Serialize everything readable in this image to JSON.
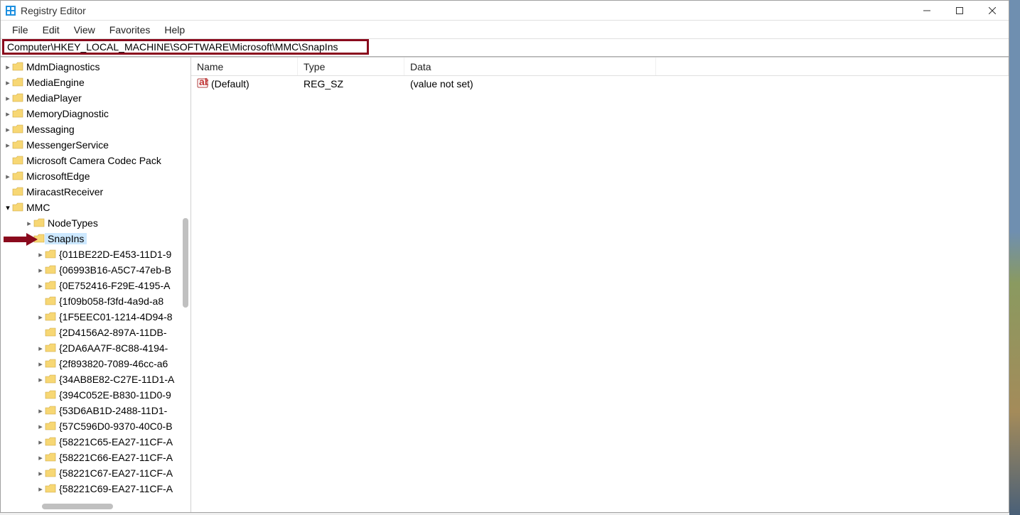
{
  "window": {
    "title": "Registry Editor"
  },
  "menu": {
    "file": "File",
    "edit": "Edit",
    "view": "View",
    "favorites": "Favorites",
    "help": "Help"
  },
  "address": {
    "value": "Computer\\HKEY_LOCAL_MACHINE\\SOFTWARE\\Microsoft\\MMC\\SnapIns"
  },
  "tree": {
    "level1": [
      {
        "label": "MdmDiagnostics",
        "chev": ">"
      },
      {
        "label": "MediaEngine",
        "chev": ">"
      },
      {
        "label": "MediaPlayer",
        "chev": ">"
      },
      {
        "label": "MemoryDiagnostic",
        "chev": ">"
      },
      {
        "label": "Messaging",
        "chev": ">"
      },
      {
        "label": "MessengerService",
        "chev": ">"
      },
      {
        "label": "Microsoft Camera Codec Pack",
        "chev": ""
      },
      {
        "label": "MicrosoftEdge",
        "chev": ">"
      },
      {
        "label": "MiracastReceiver",
        "chev": ""
      }
    ],
    "mmc": {
      "label": "MMC",
      "chev": "v"
    },
    "nodetypes": {
      "label": "NodeTypes",
      "chev": ">"
    },
    "snapins": {
      "label": "SnapIns",
      "chev": "v"
    },
    "level3": [
      {
        "label": "{011BE22D-E453-11D1-9",
        "chev": ">"
      },
      {
        "label": "{06993B16-A5C7-47eb-B",
        "chev": ">"
      },
      {
        "label": "{0E752416-F29E-4195-A",
        "chev": ">"
      },
      {
        "label": "{1f09b058-f3fd-4a9d-a8",
        "chev": ""
      },
      {
        "label": "{1F5EEC01-1214-4D94-8",
        "chev": ">"
      },
      {
        "label": "{2D4156A2-897A-11DB-",
        "chev": ""
      },
      {
        "label": "{2DA6AA7F-8C88-4194-",
        "chev": ">"
      },
      {
        "label": "{2f893820-7089-46cc-a6",
        "chev": ">"
      },
      {
        "label": "{34AB8E82-C27E-11D1-A",
        "chev": ">"
      },
      {
        "label": "{394C052E-B830-11D0-9",
        "chev": ""
      },
      {
        "label": "{53D6AB1D-2488-11D1-",
        "chev": ">"
      },
      {
        "label": "{57C596D0-9370-40C0-B",
        "chev": ">"
      },
      {
        "label": "{58221C65-EA27-11CF-A",
        "chev": ">"
      },
      {
        "label": "{58221C66-EA27-11CF-A",
        "chev": ">"
      },
      {
        "label": "{58221C67-EA27-11CF-A",
        "chev": ">"
      },
      {
        "label": "{58221C69-EA27-11CF-A",
        "chev": ">"
      }
    ]
  },
  "list": {
    "cols": {
      "name": "Name",
      "type": "Type",
      "data": "Data"
    },
    "rows": [
      {
        "name": "(Default)",
        "type": "REG_SZ",
        "data": "(value not set)"
      }
    ]
  }
}
